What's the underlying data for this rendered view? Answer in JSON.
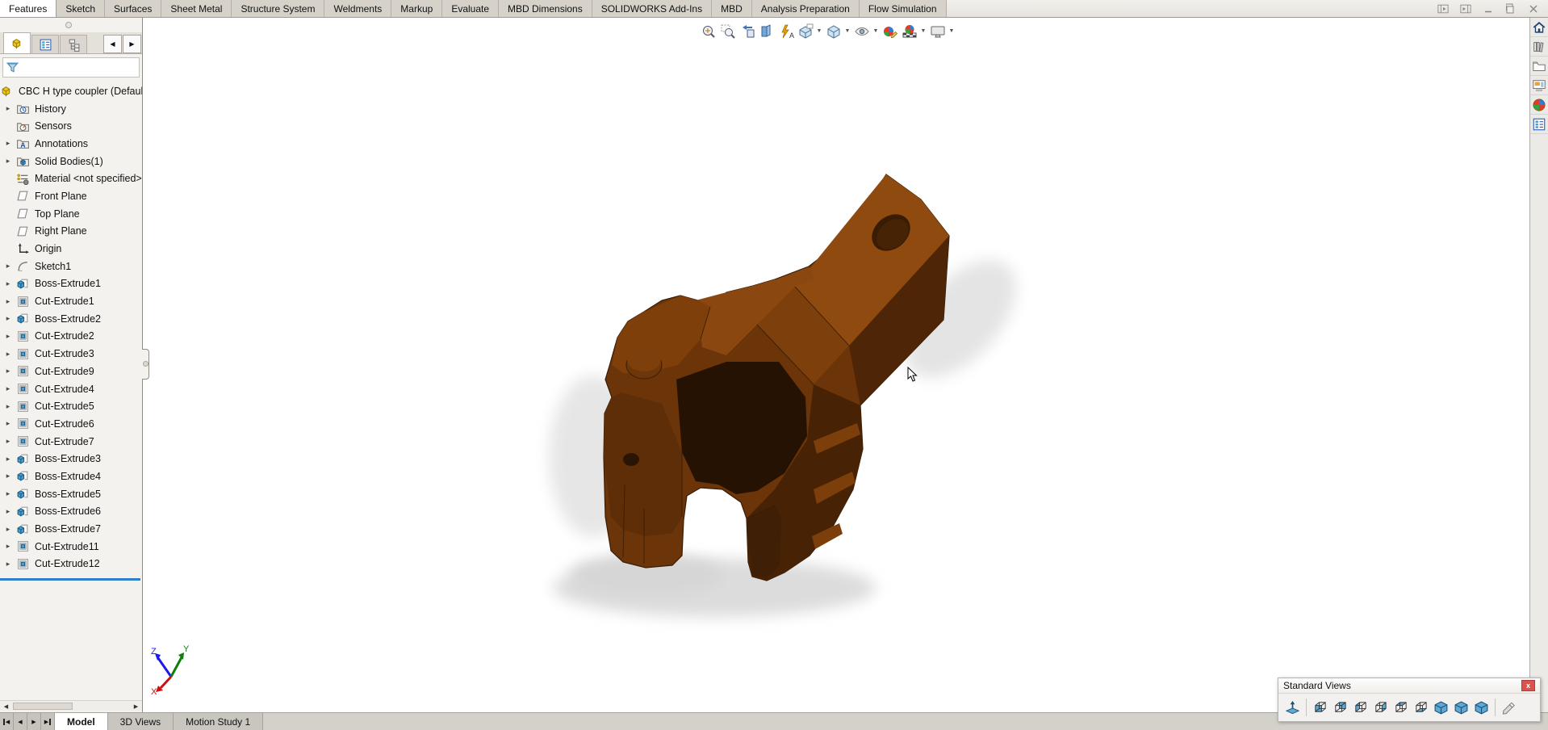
{
  "window": {
    "controls": [
      {
        "name": "collapse-left-pane",
        "icon": "pane-left-icon"
      },
      {
        "name": "collapse-right-pane",
        "icon": "pane-right-icon"
      },
      {
        "name": "minimize",
        "icon": "minimize-icon"
      },
      {
        "name": "restore",
        "icon": "restore-icon"
      },
      {
        "name": "close",
        "icon": "close-icon"
      }
    ]
  },
  "menu": {
    "tabs": [
      {
        "label": "Features",
        "active": true
      },
      {
        "label": "Sketch",
        "active": false
      },
      {
        "label": "Surfaces",
        "active": false
      },
      {
        "label": "Sheet Metal",
        "active": false
      },
      {
        "label": "Structure System",
        "active": false
      },
      {
        "label": "Weldments",
        "active": false
      },
      {
        "label": "Markup",
        "active": false
      },
      {
        "label": "Evaluate",
        "active": false
      },
      {
        "label": "MBD Dimensions",
        "active": false
      },
      {
        "label": "SOLIDWORKS Add-Ins",
        "active": false
      },
      {
        "label": "MBD",
        "active": false
      },
      {
        "label": "Analysis Preparation",
        "active": false
      },
      {
        "label": "Flow Simulation",
        "active": false
      }
    ]
  },
  "feature_panel": {
    "tabs": [
      {
        "name": "featuremanager-design-tree-tab",
        "icon": "part-root",
        "active": true
      },
      {
        "name": "propertymanager-tab",
        "icon": "property-manager",
        "active": false
      },
      {
        "name": "configurationmanager-tab",
        "icon": "configuration-manager",
        "active": false
      }
    ],
    "scroll_left": "◀",
    "scroll_right": "▶",
    "root_label": "CBC H type coupler (Default",
    "items": [
      {
        "label": "History",
        "icon": "folder-history",
        "arrow": true
      },
      {
        "label": "Sensors",
        "icon": "folder-sensors",
        "arrow": false
      },
      {
        "label": "Annotations",
        "icon": "folder-annotations",
        "arrow": true
      },
      {
        "label": "Solid Bodies(1)",
        "icon": "folder-solid-bodies",
        "arrow": true
      },
      {
        "label": "Material <not specified>",
        "icon": "material",
        "arrow": false
      },
      {
        "label": "Front Plane",
        "icon": "plane",
        "arrow": false
      },
      {
        "label": "Top Plane",
        "icon": "plane",
        "arrow": false
      },
      {
        "label": "Right Plane",
        "icon": "plane",
        "arrow": false
      },
      {
        "label": "Origin",
        "icon": "origin",
        "arrow": false
      },
      {
        "label": "Sketch1",
        "icon": "sketch",
        "arrow": true
      },
      {
        "label": "Boss-Extrude1",
        "icon": "boss-extrude",
        "arrow": true
      },
      {
        "label": "Cut-Extrude1",
        "icon": "cut-extrude",
        "arrow": true
      },
      {
        "label": "Boss-Extrude2",
        "icon": "boss-extrude",
        "arrow": true
      },
      {
        "label": "Cut-Extrude2",
        "icon": "cut-extrude",
        "arrow": true
      },
      {
        "label": "Cut-Extrude3",
        "icon": "cut-extrude",
        "arrow": true
      },
      {
        "label": "Cut-Extrude9",
        "icon": "cut-extrude",
        "arrow": true
      },
      {
        "label": "Cut-Extrude4",
        "icon": "cut-extrude",
        "arrow": true
      },
      {
        "label": "Cut-Extrude5",
        "icon": "cut-extrude",
        "arrow": true
      },
      {
        "label": "Cut-Extrude6",
        "icon": "cut-extrude",
        "arrow": true
      },
      {
        "label": "Cut-Extrude7",
        "icon": "cut-extrude",
        "arrow": true
      },
      {
        "label": "Boss-Extrude3",
        "icon": "boss-extrude",
        "arrow": true
      },
      {
        "label": "Boss-Extrude4",
        "icon": "boss-extrude",
        "arrow": true
      },
      {
        "label": "Boss-Extrude5",
        "icon": "boss-extrude",
        "arrow": true
      },
      {
        "label": "Boss-Extrude6",
        "icon": "boss-extrude",
        "arrow": true
      },
      {
        "label": "Boss-Extrude7",
        "icon": "boss-extrude",
        "arrow": true
      },
      {
        "label": "Cut-Extrude11",
        "icon": "cut-extrude",
        "arrow": true
      },
      {
        "label": "Cut-Extrude12",
        "icon": "cut-extrude",
        "arrow": true
      }
    ]
  },
  "headsup_toolbar": {
    "buttons": [
      {
        "name": "zoom-to-fit",
        "caret": false
      },
      {
        "name": "zoom-to-area",
        "caret": false
      },
      {
        "name": "previous-view",
        "caret": false
      },
      {
        "name": "section-view",
        "caret": false
      },
      {
        "name": "dynamic-annotation-views",
        "caret": false
      },
      {
        "name": "view-orientation",
        "caret": true
      },
      {
        "name": "display-style",
        "caret": true
      },
      {
        "name": "hide-show-items",
        "caret": true
      },
      {
        "name": "edit-appearance",
        "caret": false
      },
      {
        "name": "apply-scene",
        "caret": true
      },
      {
        "name": "view-settings",
        "caret": true
      }
    ]
  },
  "task_pane": {
    "buttons": [
      {
        "name": "home"
      },
      {
        "name": "design-library"
      },
      {
        "name": "file-explorer"
      },
      {
        "name": "view-palette"
      },
      {
        "name": "appearances"
      },
      {
        "name": "custom-properties"
      }
    ]
  },
  "standard_views": {
    "title": "Standard Views",
    "close_label": "x",
    "buttons": [
      {
        "name": "normal-to",
        "sep_after": true
      },
      {
        "name": "view-front",
        "sep_after": false
      },
      {
        "name": "view-back",
        "sep_after": false
      },
      {
        "name": "view-left",
        "sep_after": false
      },
      {
        "name": "view-right",
        "sep_after": false
      },
      {
        "name": "view-top",
        "sep_after": false
      },
      {
        "name": "view-bottom",
        "sep_after": false
      },
      {
        "name": "view-isometric",
        "sep_after": false
      },
      {
        "name": "view-trimetric",
        "sep_after": false
      },
      {
        "name": "view-dimetric",
        "sep_after": true
      },
      {
        "name": "view-selector",
        "sep_after": false
      }
    ]
  },
  "bottom_bar": {
    "nav": [
      {
        "name": "first-tab-button",
        "glyph": "◀",
        "bar": "left"
      },
      {
        "name": "previous-tab-button",
        "glyph": "◀",
        "bar": ""
      },
      {
        "name": "next-tab-button",
        "glyph": "▶",
        "bar": ""
      },
      {
        "name": "last-tab-button",
        "glyph": "▶",
        "bar": "right"
      }
    ],
    "tabs": [
      {
        "label": "Model",
        "active": true
      },
      {
        "label": "3D Views",
        "active": false
      },
      {
        "label": "Motion Study 1",
        "active": false
      }
    ]
  },
  "triad": {
    "x_label": "X",
    "y_label": "Y",
    "z_label": "Z"
  },
  "colors": {
    "accent": "#2f80c7",
    "chrome_bg": "#d6d2ca",
    "viewport_bg": "#ffffff",
    "close_red": "#d9534f",
    "std_view_blue": "#5fa8d3",
    "part_top": "#8f4a10",
    "part_mid": "#6b3409",
    "part_side": "#4a2306",
    "part_dark": "#251203",
    "triad_x": "#cc1111",
    "triad_y": "#0f7d0f",
    "triad_z": "#1a1aee"
  }
}
